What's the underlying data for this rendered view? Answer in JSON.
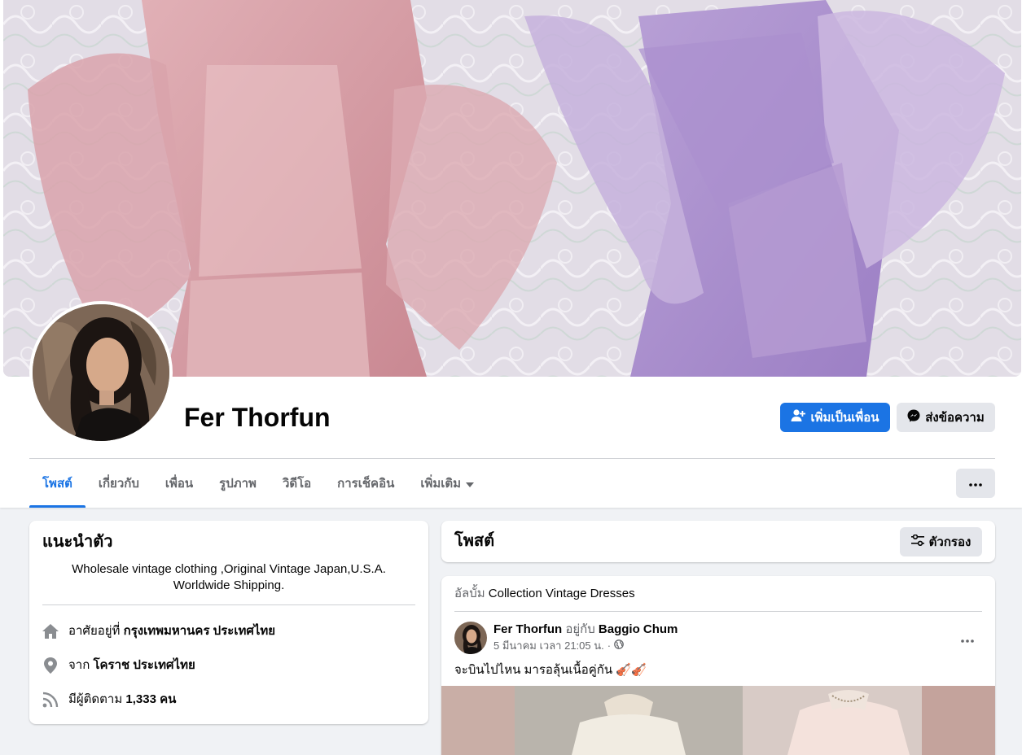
{
  "profile": {
    "name": "Fer Thorfun",
    "add_friend_label": "เพิ่มเป็นเพื่อน",
    "message_label": "ส่งข้อความ"
  },
  "tabs": [
    {
      "label": "โพสต์",
      "active": true
    },
    {
      "label": "เกี่ยวกับ",
      "active": false
    },
    {
      "label": "เพื่อน",
      "active": false
    },
    {
      "label": "รูปภาพ",
      "active": false
    },
    {
      "label": "วิดีโอ",
      "active": false
    },
    {
      "label": "การเช็คอิน",
      "active": false
    },
    {
      "label": "เพิ่มเติม",
      "active": false
    }
  ],
  "intro": {
    "title": "แนะนำตัว",
    "bio": "Wholesale vintage clothing ,Original Vintage Japan,U.S.A. Worldwide Shipping.",
    "lives_prefix": "อาศัยอยู่ที่",
    "lives_value": "กรุงเทพมหานคร ประเทศไทย",
    "from_prefix": "จาก",
    "from_value": "โคราช ประเทศไทย",
    "followers_prefix": "มีผู้ติดตาม",
    "followers_value": "1,333 คน"
  },
  "posts_section": {
    "title": "โพสต์",
    "filter_label": "ตัวกรอง"
  },
  "post": {
    "album_prefix": "อัลบั้ม",
    "album_name": "Collection Vintage Dresses",
    "author": "Fer Thorfun",
    "with_prefix": "อยู่กับ",
    "with_name": "Baggio Chum",
    "timestamp": "5 มีนาคม เวลา 21:05 น.",
    "separator": "·",
    "text": "จะบินไปไหน มารอลุ้นเนื้อคู่กัน 🎻🎻"
  },
  "colors": {
    "accent": "#1b74e4",
    "background": "#f0f2f5"
  }
}
